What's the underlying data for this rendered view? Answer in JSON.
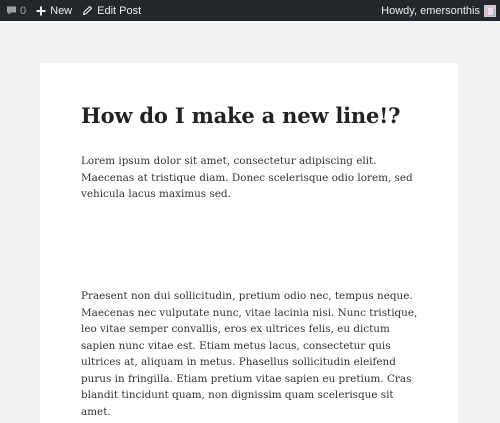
{
  "adminbar": {
    "comments_count": "0",
    "new_label": "New",
    "edit_label": "Edit Post",
    "howdy": "Howdy, emersonthis"
  },
  "post": {
    "title": "How do I make a new line!?",
    "paragraphs": [
      "Lorem ipsum dolor sit amet, consectetur adipiscing elit. Maecenas at tristique diam. Donec scelerisque odio lorem, sed vehicula lacus maximus sed.",
      "Praesent non dui sollicitudin, pretium odio nec, tempus neque. Maecenas nec vulputate nunc, vitae lacinia nisi. Nunc tristique, leo vitae semper convallis, eros ex ultrices felis, eu dictum sapien nunc vitae est. Etiam metus lacus, consectetur quis ultrices at, aliquam in metus. Phasellus sollicitudin eleifend purus in fringilla. Etiam pretium vitae sapien eu pretium. Cras blandit tincidunt quam, non dignissim quam scelerisque sit amet."
    ]
  },
  "icons": {
    "comments": "speech-bubble-icon",
    "new": "plus-icon",
    "edit": "pencil-icon"
  },
  "colors": {
    "adminbar_bg": "#23282d",
    "page_bg": "#f1f1f1",
    "card_bg": "#ffffff"
  }
}
